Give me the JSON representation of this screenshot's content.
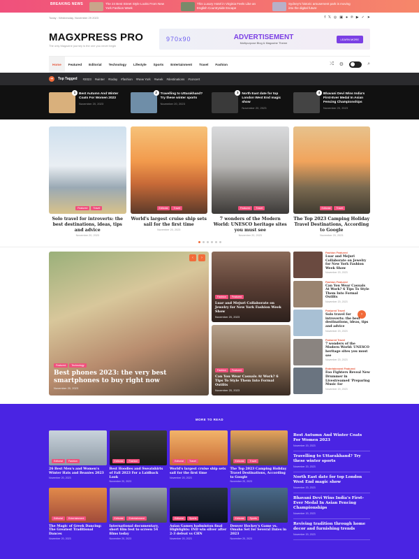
{
  "breaking": {
    "label": "BREAKING NEWS",
    "items": [
      {
        "title": "The 24 Best Street Style Looks From New York Fashion Week"
      },
      {
        "title": "This Luxury Hotel in Virginia Feels Like an English Countryside Escape"
      },
      {
        "title": "Sydney's historic amusement park is moving into the digital future"
      }
    ]
  },
  "topbar": {
    "date": "Today : Wednesday, November 29 2023"
  },
  "header": {
    "logo": "MAGXPRESS PRO",
    "tagline": "The only Magazine journey is the one you never begin"
  },
  "ad": {
    "size": "970x90",
    "title": "ADVERTISEMENT",
    "subtitle": "Multipurpose Blog & Magazine Theme",
    "button": "LEARN MORE"
  },
  "nav": {
    "items": [
      "Home",
      "Featured",
      "Editorial",
      "Technology",
      "Lifestyle",
      "Sports",
      "Entertainment",
      "Travel",
      "Fashion"
    ]
  },
  "tagged": {
    "title": "Top Tagged",
    "tags": [
      "#2023",
      "#winter",
      "#today",
      "#fashion",
      "#New York",
      "#week",
      "#destinations",
      "#concert"
    ]
  },
  "trending": [
    {
      "num": "1",
      "title": "Best Autumn And Winter Coats For Women 2023",
      "date": "November 20, 2023",
      "color": "#d9b07c"
    },
    {
      "num": "2",
      "title": "Travelling to Uttarakhand? Try these winter sports",
      "date": "November 20, 2023",
      "color": "#6f8ea8"
    },
    {
      "num": "3",
      "title": "North East date for top London West End magic show",
      "date": "November 20, 2023",
      "color": "#3a3a3a"
    },
    {
      "num": "4",
      "title": "Bhavani Devi Wins India's First-Ever Medal In Asian Fencing Championships",
      "date": "November 20, 2023",
      "color": "#444"
    }
  ],
  "slider": [
    {
      "title": "Solo travel for introverts: the best destinations, ideas, tips and advice",
      "date": "November 20, 2023",
      "badges": [
        "Featured",
        "Travel"
      ],
      "bg": "linear-gradient(180deg,#cfe0ee 0%,#e9eef3 45%,#9aa9b4 70%,#d8c28a 100%)"
    },
    {
      "title": "World's largest cruise ship sets sail for the first time",
      "date": "November 20, 2023",
      "badges": [
        "Editorial",
        "Travel"
      ],
      "bg": "linear-gradient(180deg,#f6c27a 0%,#f29a4c 40%,#c96b38 65%,#5c3a2a 100%)"
    },
    {
      "title": "7 wonders of the Modern World: UNESCO heritage sites you must see",
      "date": "November 20, 2023",
      "badges": [
        "Featured",
        "Travel"
      ],
      "bg": "linear-gradient(180deg,#d9dadc 0%,#b8b7b5 45%,#6e6a66 75%,#3c3a38 100%)"
    },
    {
      "title": "The Top 2023 Camping Holiday Travel Destinations, According to Google",
      "date": "November 20, 2023",
      "badges": [
        "Editorial",
        "Travel"
      ],
      "bg": "linear-gradient(180deg,#e7c28c 0%,#f1a45c 40%,#7b6a50 70%,#3f3a30 100%)"
    }
  ],
  "featured_big": {
    "title": "Best phones 2023: the very best smartphones to buy right now",
    "date": "November 20, 2023",
    "badges": [
      "Featured",
      "Technology"
    ]
  },
  "featured_mid": [
    {
      "title": "Luar and Mejuri Collaborate on Jewelry for New York Fashion Week Show",
      "date": "November 20, 2023",
      "badges": [
        "Fashion",
        "Featured"
      ],
      "bg": "linear-gradient(180deg,#8a6a58 0%,#5a3e34 50%,#2c201c 100%)"
    },
    {
      "title": "Can You Wear Casuals At Work? 6 Tips To Style Them Into Formal Outfits",
      "date": "November 20, 2023",
      "badges": [
        "Fashion",
        "Featured"
      ],
      "bg": "linear-gradient(180deg,#b7a28c 0%,#8a6e56 50%,#3a2c24 100%)"
    }
  ],
  "featured_side": [
    {
      "cat": "Fashion Featured",
      "title": "Luar and Mejuri Collaborate on Jewelry for New York Fashion Week Show",
      "date": "November 20, 2023",
      "color": "#6a4a40"
    },
    {
      "cat": "Fashion Featured",
      "title": "Can You Wear Casuals At Work? 6 Tips To Style Them Into Formal Outfits",
      "date": "November 20, 2023",
      "color": "#9a8470"
    },
    {
      "cat": "Featured Travel",
      "title": "Solo travel for introverts: the best destinations, ideas, tips and advice",
      "date": "November 20, 2023",
      "color": "#a8c0d4"
    },
    {
      "cat": "Featured Travel",
      "title": "7 wonders of the Modern World: UNESCO heritage sites you must see",
      "date": "November 20, 2023",
      "color": "#8a8480"
    },
    {
      "cat": "Entertainment Featured",
      "title": "Foo Fighters Reveal New Drummer in Livestreamed 'Preparing Music for",
      "date": "November 20, 2023",
      "color": "#6a7480"
    }
  ],
  "more": {
    "title": "MORE TO READ",
    "cards": [
      {
        "title": "26 Best Men's and Women's Winter Hats and Beanies 2023",
        "date": "November 20, 2023",
        "badges": [
          "Editorial",
          "Fashion"
        ],
        "bg": "linear-gradient(180deg,#c9d3dc,#8f9ba6)"
      },
      {
        "title": "Best Hoodies and Sweatshirts of Fall 2023 For a Laidback Look",
        "date": "November 20, 2023",
        "badges": [
          "Editorial",
          "Fashion"
        ],
        "bg": "linear-gradient(180deg,#3a3a3a,#1a1a1a)"
      },
      {
        "title": "World's largest cruise ship sets sail for the first time",
        "date": "November 20, 2023",
        "badges": [
          "Editorial",
          "Travel"
        ],
        "bg": "linear-gradient(180deg,#f2b46a,#c96b38)"
      },
      {
        "title": "The Top 2023 Camping Holiday Travel Destinations, According to Google",
        "date": "November 20, 2023",
        "badges": [
          "Editorial",
          "Travel"
        ],
        "bg": "linear-gradient(180deg,#e7a45c,#5c4a38)"
      },
      {
        "title": "The Magic of Greek Dancing: The Greatest Traditional Dances",
        "date": "November 20, 2023",
        "badges": [
          "Editorial",
          "Entertainment"
        ],
        "bg": "linear-gradient(180deg,#e28a4a,#a04a3a)"
      },
      {
        "title": "International documentary, short film fest to screen 54 films today",
        "date": "November 20, 2023",
        "badges": [
          "Editorial",
          "Entertainment"
        ],
        "bg": "linear-gradient(180deg,#9aa0a8,#4a4e54)"
      },
      {
        "title": "Asian Games badminton final Highlights: IND win silver after 2-3 defeat vs CHN",
        "date": "November 20, 2023",
        "badges": [
          "Editorial",
          "Sports"
        ],
        "bg": "linear-gradient(180deg,#2a3444,#0e1420)"
      },
      {
        "title": "Denver Hockey's Game vs. Omaha Set for Several Dates in 2023",
        "date": "November 20, 2023",
        "badges": [
          "Editorial",
          "Sports"
        ],
        "bg": "linear-gradient(180deg,#4a6a8a,#2a3a4a)"
      }
    ],
    "list": [
      {
        "title": "Best Autumn And Winter Coats For Women 2023",
        "date": "November 20, 2023"
      },
      {
        "title": "Travelling to Uttarakhand? Try these winter sports",
        "date": "November 20, 2023"
      },
      {
        "title": "North East date for top London West End magic show",
        "date": "November 20, 2023"
      },
      {
        "title": "Bhavani Devi Wins India's First-Ever Medal In Asian Fencing Championships",
        "date": "November 20, 2023"
      },
      {
        "title": "Reviving tradition through home decor and furnishing trends",
        "date": "November 20, 2023"
      }
    ]
  }
}
